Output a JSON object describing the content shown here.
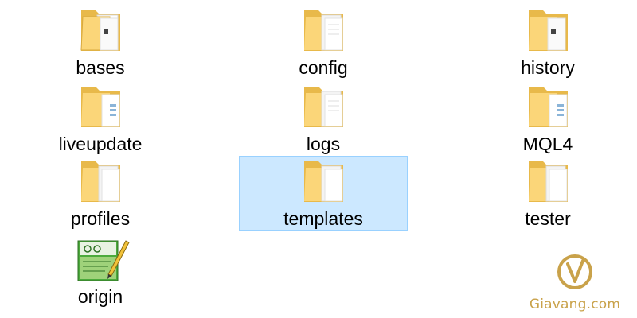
{
  "explorer": {
    "items": [
      {
        "id": "bases",
        "label": "bases",
        "type": "folder",
        "variant": "doc-badge",
        "selected": false
      },
      {
        "id": "config",
        "label": "config",
        "type": "folder",
        "variant": "papers",
        "selected": false
      },
      {
        "id": "history",
        "label": "history",
        "type": "folder",
        "variant": "doc-badge",
        "selected": false
      },
      {
        "id": "liveupdate",
        "label": "liveupdate",
        "type": "folder",
        "variant": "papers-blue",
        "selected": false
      },
      {
        "id": "logs",
        "label": "logs",
        "type": "folder",
        "variant": "papers",
        "selected": false
      },
      {
        "id": "mql4",
        "label": "MQL4",
        "type": "folder",
        "variant": "papers-blue",
        "selected": false
      },
      {
        "id": "profiles",
        "label": "profiles",
        "type": "folder",
        "variant": "papers",
        "selected": false
      },
      {
        "id": "templates",
        "label": "templates",
        "type": "folder",
        "variant": "papers",
        "selected": true
      },
      {
        "id": "tester",
        "label": "tester",
        "type": "folder",
        "variant": "papers",
        "selected": false
      },
      {
        "id": "origin",
        "label": "origin",
        "type": "file",
        "variant": "notepad-file",
        "selected": false
      }
    ]
  },
  "watermark": {
    "text": "Giavang.com",
    "color": "#c9a24a"
  },
  "colors": {
    "folder_back": "#e8b94a",
    "folder_front": "#fbd679",
    "selection_bg": "#cce8ff",
    "selection_border": "#99d1ff"
  }
}
